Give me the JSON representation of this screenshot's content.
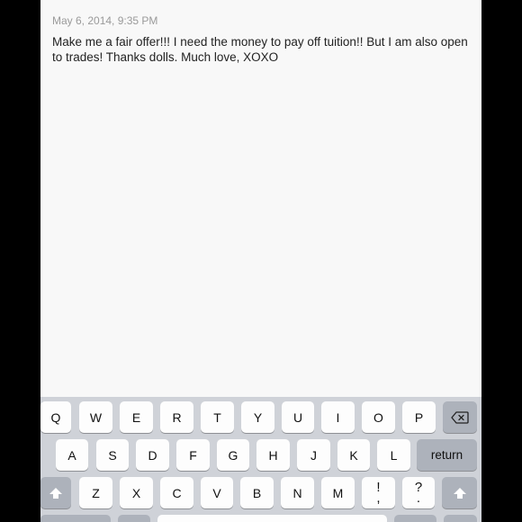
{
  "note": {
    "date": "May 6, 2014, 9:35 PM",
    "body": "Make me a fair offer!!! I need the money to pay off tuition!! But I am also open to trades! Thanks dolls. Much love, XOXO"
  },
  "keyboard": {
    "row1": [
      "Q",
      "W",
      "E",
      "R",
      "T",
      "Y",
      "U",
      "I",
      "O",
      "P"
    ],
    "row2": [
      "A",
      "S",
      "D",
      "F",
      "G",
      "H",
      "J",
      "K",
      "L"
    ],
    "row3": [
      "Z",
      "X",
      "C",
      "V",
      "B",
      "N",
      "M"
    ],
    "return_label": "return",
    "punct1_top": "!",
    "punct1_bottom": ",",
    "punct2_top": "?",
    "punct2_bottom": ".",
    "icons": {
      "delete": "delete-icon",
      "shift": "shift-icon"
    }
  }
}
